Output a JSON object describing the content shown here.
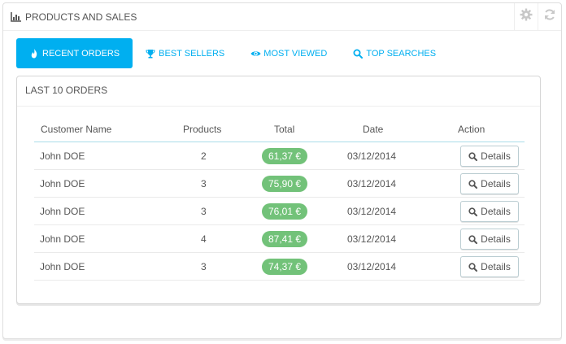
{
  "panel": {
    "title": "PRODUCTS AND SALES",
    "title_icon": "bar-chart-icon",
    "tools": [
      "gear-icon",
      "refresh-icon"
    ]
  },
  "tabs": [
    {
      "label": "RECENT ORDERS",
      "icon": "flame-icon",
      "active": true
    },
    {
      "label": "BEST SELLERS",
      "icon": "trophy-icon",
      "active": false
    },
    {
      "label": "MOST VIEWED",
      "icon": "eye-icon",
      "active": false
    },
    {
      "label": "TOP SEARCHES",
      "icon": "search-icon",
      "active": false
    }
  ],
  "orders": {
    "heading": "LAST 10 ORDERS",
    "columns": [
      "Customer Name",
      "Products",
      "Total",
      "Date",
      "Action"
    ],
    "rows": [
      {
        "customer": "John DOE",
        "products": "2",
        "total": "61,37 €",
        "date": "03/12/2014",
        "action": "Details"
      },
      {
        "customer": "John DOE",
        "products": "3",
        "total": "75,90 €",
        "date": "03/12/2014",
        "action": "Details"
      },
      {
        "customer": "John DOE",
        "products": "3",
        "total": "76,01 €",
        "date": "03/12/2014",
        "action": "Details"
      },
      {
        "customer": "John DOE",
        "products": "4",
        "total": "87,41 €",
        "date": "03/12/2014",
        "action": "Details"
      },
      {
        "customer": "John DOE",
        "products": "3",
        "total": "74,37 €",
        "date": "03/12/2014",
        "action": "Details"
      }
    ]
  },
  "colors": {
    "accent": "#00aff0",
    "badge_green": "#72c279",
    "text": "#555555"
  }
}
